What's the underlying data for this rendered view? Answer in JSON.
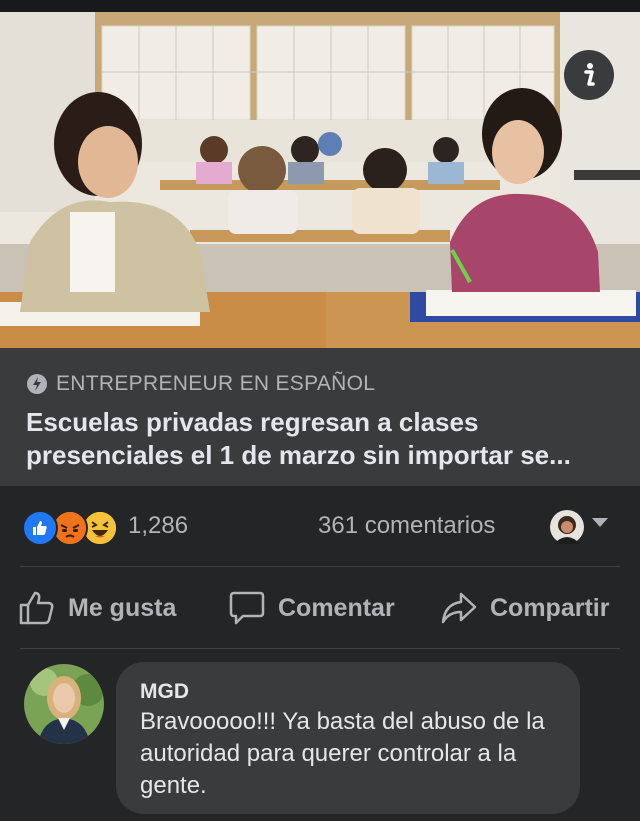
{
  "post": {
    "link_source": "ENTREPRENEUR EN ESPAÑOL",
    "headline": "Escuelas privadas regresan a clases presenciales el 1 de marzo sin importar se...",
    "image_icon": "info-icon"
  },
  "stats": {
    "reactions": [
      "like-icon",
      "angry-icon",
      "haha-icon"
    ],
    "reaction_count": "1,286",
    "comment_count": "361 comentarios"
  },
  "actions": {
    "like_label": "Me gusta",
    "comment_label": "Comentar",
    "share_label": "Compartir"
  },
  "comment": {
    "author": "MGD",
    "text": "Bravooooo!!! Ya basta del abuso de la autoridad para querer controlar a la gente."
  },
  "colors": {
    "background": "#242526",
    "card": "#3a3b3c",
    "like_blue": "#2078f4",
    "text_secondary": "#b0b3b8"
  }
}
